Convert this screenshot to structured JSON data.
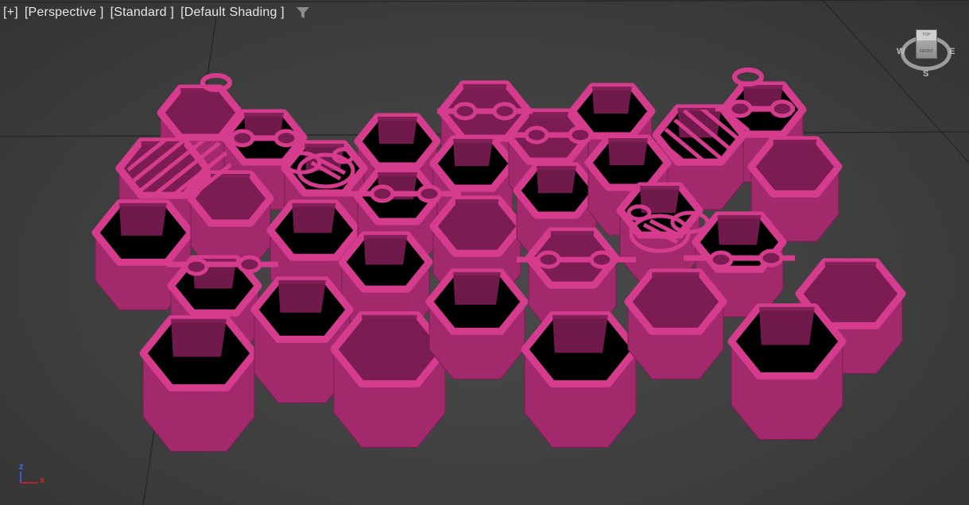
{
  "viewport_labels": {
    "plus": "[+]",
    "view": "[Perspective ]",
    "mode": "[Standard ]",
    "shading": "[Default Shading ]"
  },
  "icons": {
    "filter": "funnel-filter-icon",
    "viewcube": "viewcube-navigation-icon",
    "axis": "world-axis-tripod-icon"
  },
  "viewcube": {
    "top_face": "TOP",
    "front_face": "FRONT",
    "north": "",
    "west": "W",
    "east": "E",
    "south": "S"
  },
  "axis": {
    "z": "z",
    "x": "x"
  },
  "colors": {
    "background": "#3f3f3f",
    "grid_line": "#222222",
    "model_bright": "#d63c8e",
    "model_mid": "#a22a6c",
    "model_dark": "#7b1d52",
    "model_interior": "#000000",
    "axis_z": "#3a6bff",
    "axis_x": "#e02020"
  }
}
